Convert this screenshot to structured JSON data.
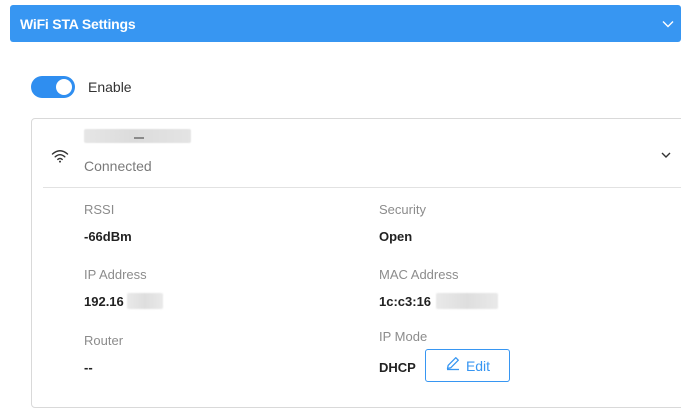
{
  "header": {
    "title": "WiFi STA Settings",
    "chevron_icon": "chevron-down-icon"
  },
  "enable": {
    "label": "Enable",
    "state": "on"
  },
  "network": {
    "status": "Connected",
    "wifi_icon": "wifi-icon"
  },
  "details": {
    "rssi": {
      "label": "RSSI",
      "value": "-66dBm"
    },
    "security": {
      "label": "Security",
      "value": "Open"
    },
    "ip_address": {
      "label": "IP Address",
      "value": "192.16"
    },
    "mac_address": {
      "label": "MAC Address",
      "value": "1c:c3:16"
    },
    "router": {
      "label": "Router",
      "value": "--"
    },
    "ip_mode": {
      "label": "IP Mode",
      "value": "DHCP"
    }
  },
  "edit_button": {
    "label": "Edit",
    "icon": "pencil-icon"
  },
  "colors": {
    "accent": "#3796f2",
    "toggle_on": "#2f8ef0",
    "muted_text": "#8c8c8c"
  }
}
